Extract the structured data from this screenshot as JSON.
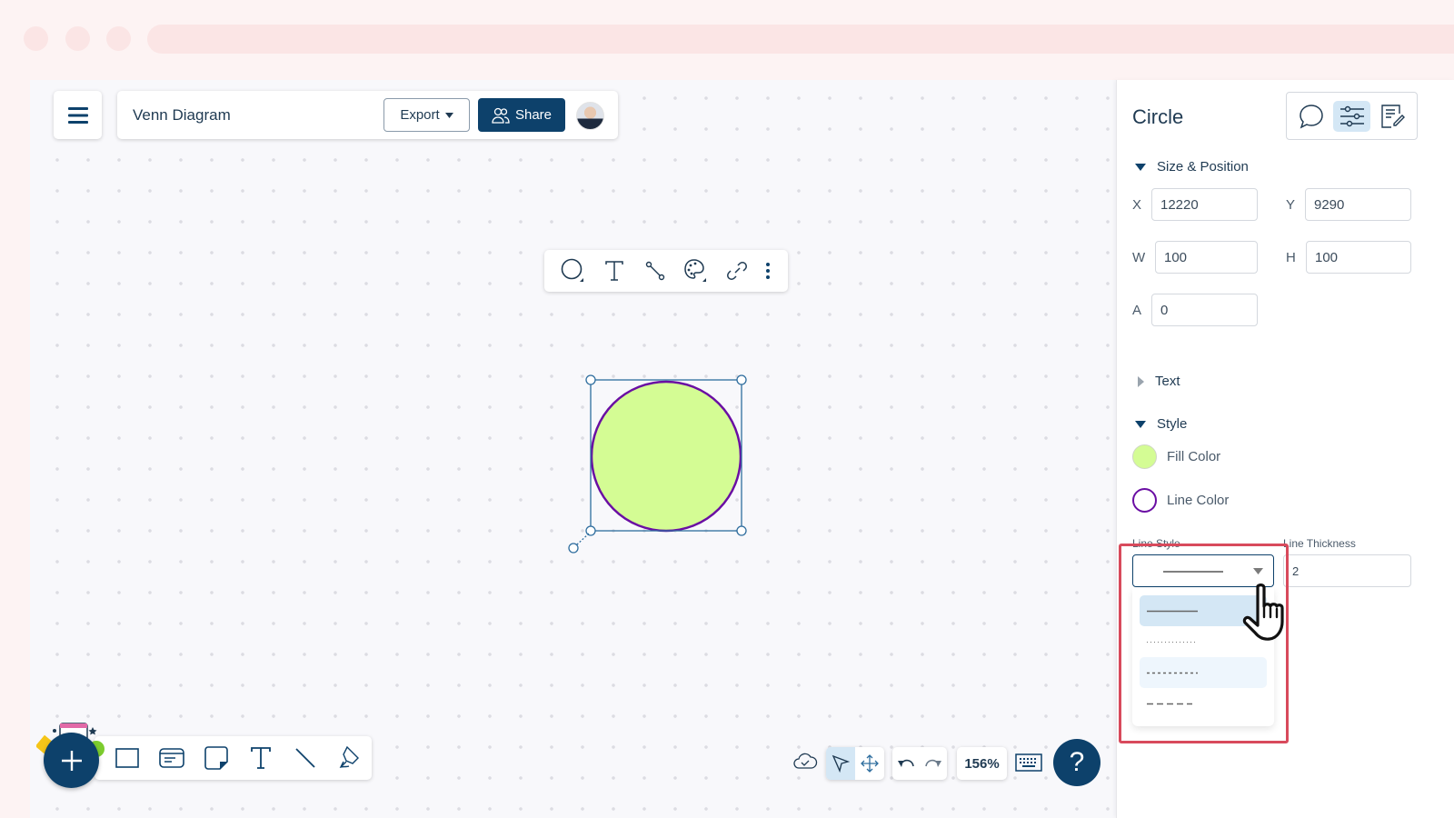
{
  "header": {
    "menu_icon": "hamburger-menu-icon",
    "document_title": "Venn Diagram",
    "export_label": "Export",
    "share_label": "Share",
    "avatar_alt": "user-avatar"
  },
  "context_toolbar": {
    "items": [
      {
        "name": "shape-picker",
        "icon": "circle-shape-icon"
      },
      {
        "name": "text",
        "icon": "text-icon"
      },
      {
        "name": "connector",
        "icon": "connector-icon"
      },
      {
        "name": "style-palette",
        "icon": "palette-icon"
      },
      {
        "name": "link",
        "icon": "link-icon"
      },
      {
        "name": "more",
        "icon": "more-vertical-icon"
      }
    ]
  },
  "canvas": {
    "selected_shape": {
      "type": "circle",
      "fill_color": "#d4fc94",
      "line_color": "#6a0ea3",
      "selection_color": "#2e6d9e"
    }
  },
  "bottom_toolbar": {
    "add_icon": "plus-icon",
    "tools": [
      {
        "name": "rectangle",
        "icon": "rectangle-icon"
      },
      {
        "name": "card",
        "icon": "card-icon"
      },
      {
        "name": "sticky-note",
        "icon": "sticky-note-icon"
      },
      {
        "name": "text",
        "icon": "text-icon"
      },
      {
        "name": "line",
        "icon": "line-icon"
      },
      {
        "name": "pen",
        "icon": "pen-icon"
      }
    ]
  },
  "bottom_controls": {
    "save_status_icon": "cloud-check-icon",
    "modes": [
      {
        "name": "select",
        "icon": "pointer-icon",
        "active": true
      },
      {
        "name": "pan",
        "icon": "move-icon",
        "active": false
      }
    ],
    "undo_icon": "undo-icon",
    "redo_icon": "redo-icon",
    "zoom_level": "156%",
    "keyboard_icon": "keyboard-icon",
    "help_label": "?"
  },
  "panel": {
    "title": "Circle",
    "tabs": [
      {
        "name": "comments",
        "icon": "comment-icon",
        "active": false
      },
      {
        "name": "properties",
        "icon": "sliders-icon",
        "active": true
      },
      {
        "name": "notes",
        "icon": "edit-note-icon",
        "active": false
      }
    ],
    "size_position": {
      "heading": "Size & Position",
      "expanded": true,
      "x_label": "X",
      "x_value": "12220",
      "y_label": "Y",
      "y_value": "9290",
      "w_label": "W",
      "w_value": "100",
      "h_label": "H",
      "h_value": "100",
      "a_label": "A",
      "a_value": "0"
    },
    "text_section": {
      "heading": "Text",
      "expanded": false
    },
    "style_section": {
      "heading": "Style",
      "expanded": true,
      "fill_label": "Fill Color",
      "fill_color": "#d4fc94",
      "line_label": "Line Color",
      "line_color": "#6a0ea3",
      "line_style_label": "Line Style",
      "line_style_value": "solid",
      "line_thickness_label": "Line Thickness",
      "line_thickness_value": "2",
      "line_style_options": [
        {
          "value": "solid",
          "state": "selected"
        },
        {
          "value": "dotted",
          "state": "normal"
        },
        {
          "value": "dash-dot",
          "state": "hover"
        },
        {
          "value": "dashed",
          "state": "normal"
        }
      ]
    }
  },
  "annotation": {
    "highlight_color": "#d84a5c",
    "cursor": "hand-pointer"
  }
}
